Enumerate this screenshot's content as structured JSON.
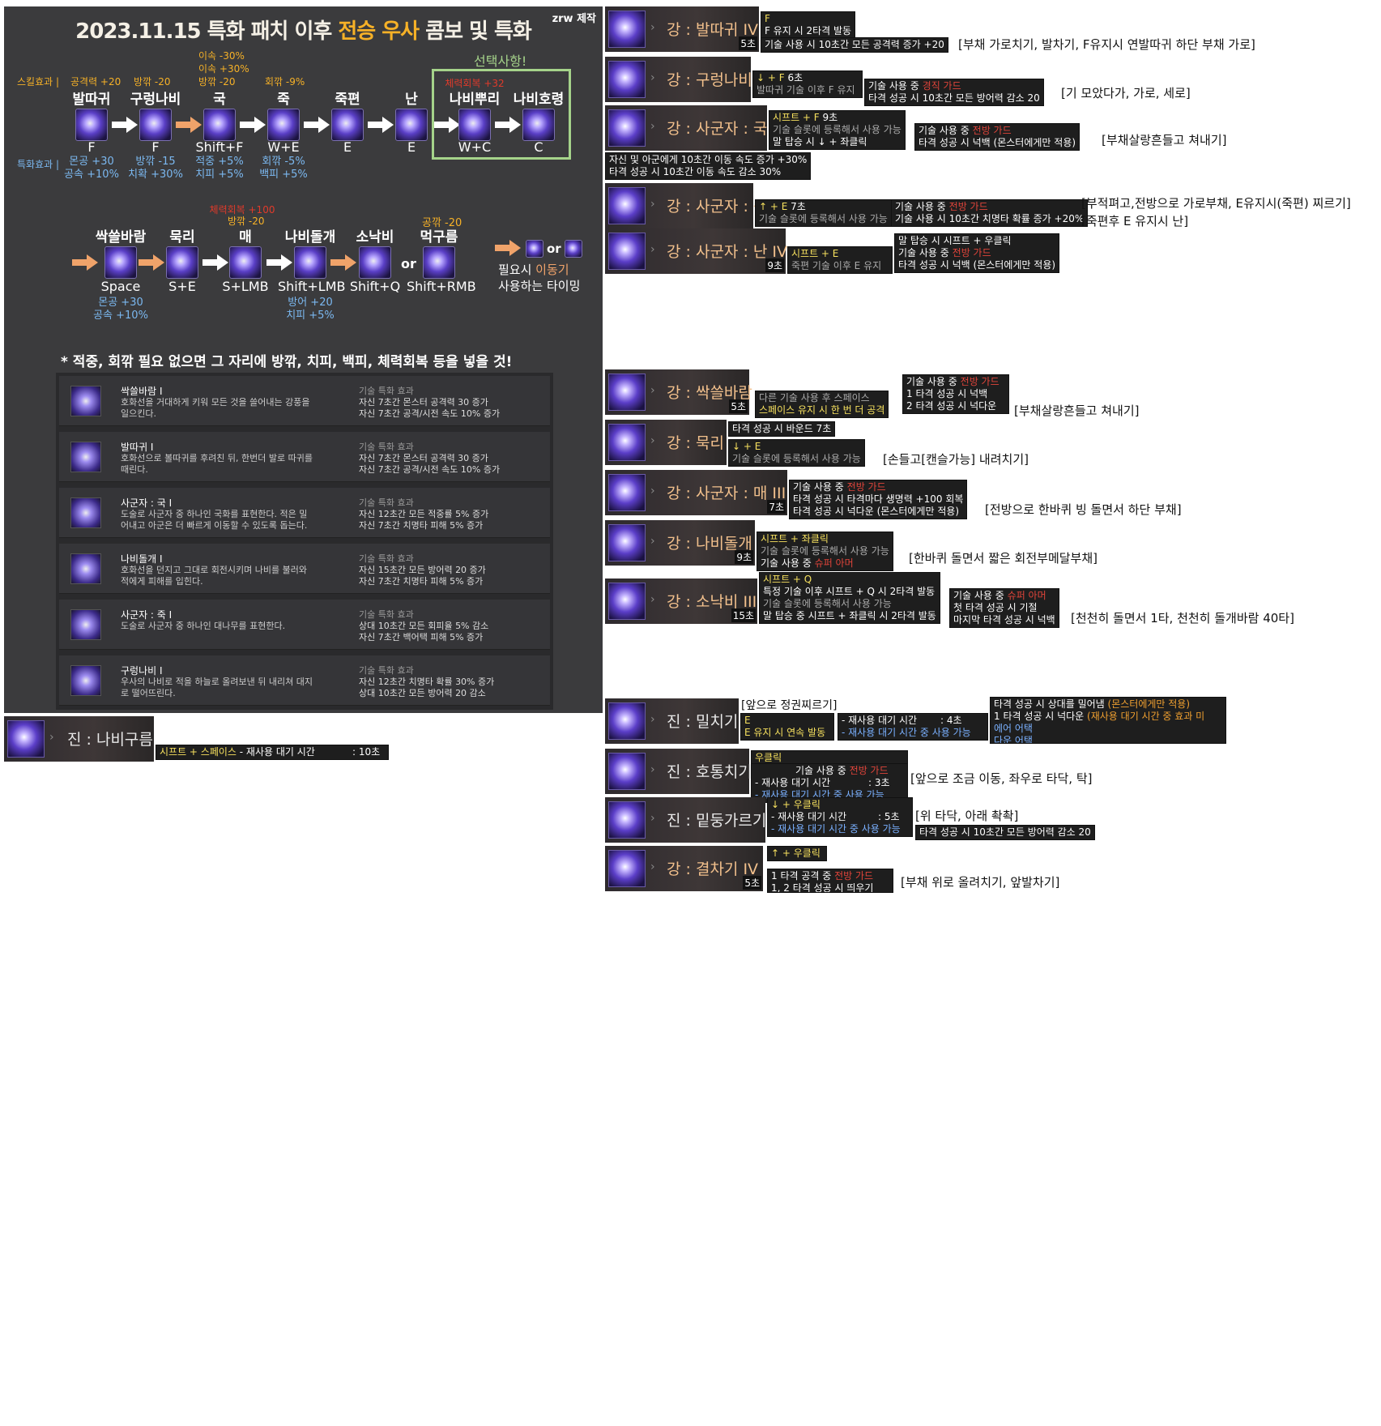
{
  "guide": {
    "title_pre": "2023.11.15 특화 패치 이후 ",
    "title_hl1": "전승 우사",
    "title_mid": " 콤보 및 특화",
    "credit": "zrw 제작",
    "skill_effect_label": "스킬효과 |",
    "spec_effect_label": "특화효과 |",
    "select_label": "선택사항!",
    "row1": [
      {
        "top": "공격력 +20",
        "name": "발따귀",
        "key": "F",
        "buff1": "몬공 +30",
        "buff2": "공속 +10%"
      },
      {
        "top": "방깎 -20",
        "name": "구렁나비",
        "key": "F",
        "buff1": "방깎 -15",
        "buff2": "치확 +30%"
      },
      {
        "top": "이속 -30%",
        "top2": "이속 +30%",
        "top3": "방깎 -20",
        "name": "국",
        "key": "Shift+F",
        "buff1": "적중 +5%",
        "buff2": "치피 +5%"
      },
      {
        "top": "회깎 -9%",
        "name": "죽",
        "key": "W+E",
        "buff1": "회깎 -5%",
        "buff2": "백피 +5%"
      },
      {
        "name": "죽편",
        "key": "E"
      },
      {
        "name": "난",
        "key": "E"
      },
      {
        "top_red": "체력회복 +32",
        "name": "나비뿌리",
        "key": "W+C"
      },
      {
        "name": "나비호령",
        "key": "C"
      }
    ],
    "row2": [
      {
        "name": "싹쓸바람",
        "key": "Space",
        "buff1": "몬공 +30",
        "buff2": "공속 +10%"
      },
      {
        "name": "묵리",
        "key": "S+E"
      },
      {
        "top_red": "체력회복 +100",
        "top": "방깎 -20",
        "name": "매",
        "key": "S+LMB"
      },
      {
        "name": "나비돌개",
        "key": "Shift+LMB",
        "buff1": "방어 +20",
        "buff2": "치피 +5%"
      },
      {
        "name": "소낙비",
        "key": "Shift+Q"
      },
      {
        "top": "공깎 -20",
        "name": "먹구름",
        "key": "Shift+RMB"
      }
    ],
    "or1": "or",
    "or2": "or",
    "move_note1": "필요시 ",
    "move_note_hl": "이동기",
    "move_note2": "사용하는 타이밍",
    "note": "* 적중, 회깎 필요 없으면 그 자리에 방깎, 치피, 백피, 체력회복 등을 넣을 것!",
    "effect_header": "기술 특화 효과",
    "table": [
      {
        "name": "싹쓸바람 I",
        "desc": "호화선을 거대하게 키워 모든 것을 쓸어내는 강풍을 일으킨다.",
        "e1": "자신 7초간 몬스터 공격력 30 증가",
        "e2": "자신 7초간 공격/시전 속도 10% 증가"
      },
      {
        "name": "발따귀 I",
        "desc": "호화선으로 볼따귀를 후려친 뒤, 한번더 발로 따귀를 때린다.",
        "e1": "자신 7초간 몬스터 공격력 30 증가",
        "e2": "자신 7초간 공격/시전 속도 10% 증가"
      },
      {
        "name": "사군자 : 국 I",
        "desc": "도술로 사군자 중 하나인 국화를 표현한다. 적은 밀어내고 아군은 더 빠르게 이동할 수 있도록 돕는다.",
        "e1": "자신 12초간 모든 적중률 5% 증가",
        "e2": "자신 7초간 치명타 피해 5% 증가"
      },
      {
        "name": "나비돌개 I",
        "desc": "호화선을 던지고 그대로 회전시키며 나비를 불러와 적에게 피해를 입힌다.",
        "e1": "자신 15초간 모든 방어력 20 증가",
        "e2": "자신 7초간 치명타 피해 5% 증가"
      },
      {
        "name": "사군자 : 죽 I",
        "desc": "도술로 사군자 중 하나인 대나무를 표현한다.",
        "e1": "상대 10초간 모든 회피율 5% 감소",
        "e2": "자신 7초간 백어택 피해 5% 증가"
      },
      {
        "name": "구렁나비 I",
        "desc": "우사의 나비로 적을 하늘로 올려보낸 뒤 내리쳐 대지로 떨어뜨린다.",
        "e1": "자신 12초간 치명타 확률 30% 증가",
        "e2": "상대 10초간 모든 방어력 20 감소"
      }
    ]
  },
  "bottom_skill": {
    "name": "진 : 나비구름",
    "keys": "시프트 + 스페이스",
    "cd_label": " - 재사용 대기 시간",
    "cd": ": 10초"
  },
  "skills": [
    {
      "name": "강 : 발따귀 IV",
      "cd": "5초",
      "tt1a": "F",
      "tt1b": "F 유지 시 2타격 발동",
      "tt2": "기술 사용 시 10초간 모든 공격력 증가 +20",
      "caption": "[부채 가로치기, 발차기, F유지시 연발따귀 하단 부채 가로]"
    },
    {
      "name": "강 : 구렁나비",
      "tt1a": "↓ + F",
      "tt1cd": "6초",
      "tt1b": "발따귀 기술 이후 F 유지",
      "tt2a": "기술 사용 중 ",
      "tt2ar": "경직 가드",
      "tt2b": "타격 성공 시 10초간 모든 방어력 감소 20",
      "caption": "[기 모았다가, 가로, 세로]"
    },
    {
      "name": "강 : 사군자 : 국",
      "tt1a": "시프트 + F",
      "tt1cd": "9초",
      "tt1b": "기술 슬롯에 등록해서 사용 가능",
      "tt1c": "말 탑승 시 ↓ + 좌클릭",
      "tt2a": "기술 사용 중 ",
      "tt2ar": "전방 가드",
      "tt2b": "타격 성공 시 넉백 (몬스터에게만 적용)",
      "tt3a": "자신 및 아군에게 10초간 이동 속도 증가 +30%",
      "tt3b": "타격 성공 시 10초간 이동 속도 감소 30%",
      "caption": "[부채살랑흔들고 쳐내기]"
    },
    {
      "name": "강 : 사군자 : 죽",
      "tt1a": "↑ + E",
      "tt1cd": "7초",
      "tt1b": "기술 슬롯에 등록해서 사용 가능",
      "tt2a": "기술 사용 중 ",
      "tt2ar": "전방 가드",
      "tt2b": "기술 사용 시 10초간 치명타 확률 증가 +20%",
      "caption1": "[부적펴고,전방으로 가로부채, E유지시(죽편) 찌르기]",
      "caption2": "[죽편후 E 유지시 난]"
    },
    {
      "name": "강 : 사군자 : 난 IV",
      "cd": "9초",
      "tt1a": "시프트 + E",
      "tt1b": "죽편 기술 이후 E 유지",
      "tt2a": "말 탑승 시 시프트 + 우클릭",
      "tt2b": "기술 사용 중 ",
      "tt2br": "전방 가드",
      "tt2c": "타격 성공 시 넉백 (몬스터에게만 적용)"
    },
    {
      "name": "강 : 싹쓸바람",
      "cd": "5초",
      "tt1a": "다른 기술 사용 후 스페이스",
      "tt1b": "스페이스 유지 시 한 번 더 공격",
      "tt2a": "기술 사용 중 ",
      "tt2ar": "전방 가드",
      "tt2b": "1 타격 성공 시 넉백",
      "tt2c": "2 타격 성공 시 넉다운",
      "caption": "[부채살랑흔들고 쳐내기]"
    },
    {
      "name": "강 : 묵리",
      "tt0": "타격 성공 시 바운드",
      "tt0cd": "7초",
      "tt1a": "↓ + E",
      "tt1b": "기술 슬롯에 등록해서 사용 가능",
      "caption": "[손들고[캔슬가능] 내려치기]"
    },
    {
      "name": "강 : 사군자 : 매 III",
      "cd": "7초",
      "tt1a": "기술 사용 중 ",
      "tt1ar": "전방 가드",
      "tt1b": "타격 성공 시 타격마다 생명력 +100 회복",
      "tt1c": "타격 성공 시 넉다운 (몬스터에게만 적용)",
      "caption": "[전방으로 한바퀴 빙 돌면서 하단 부채]"
    },
    {
      "name": "강 : 나비돌개",
      "cd": "9초",
      "tt1a": "시프트 + 좌클릭",
      "tt1b": "기술 슬롯에 등록해서 사용 가능",
      "tt1c": "기술 사용 중 ",
      "tt1cr": "슈퍼 아머",
      "caption": "[한바퀴 돌면서 짧은 회전부메달부채]"
    },
    {
      "name": "강 : 소낙비 III",
      "cd": "15초",
      "tt1a": "시프트 + Q",
      "tt1b": "특정 기술 이후 시프트 + Q 시 2타격 발동",
      "tt1c": "기술 슬롯에 등록해서 사용 가능",
      "tt1d": "말 탑승 중 시프트 + 좌클릭 시 2타격 발동",
      "tt2a": "기술 사용 중 ",
      "tt2ar": "슈퍼 아머",
      "tt2b": "첫 타격 성공 시 기절",
      "tt2c": "마지막 타격 성공 시 넉백",
      "caption": "[천천히 돌면서 1타, 천천히 돌개바람 40타]"
    },
    {
      "name": "진 : 밀치기",
      "caption_top": "[앞으로 정권찌르기]",
      "tt1a": "E",
      "tt1b": "E 유지 시 연속 발동",
      "tt2a": "- 재사용 대기 시간",
      "tt2acd": ": 4초",
      "tt2b": "- 재사용 대기 시간 중 사용 가능",
      "tt3a": "타격 성공 시 상대를 밀어냄 ",
      "tt3ar": "(몬스터에게만 적용)",
      "tt3b": "1 타격 성공 시 넉다운 ",
      "tt3br": "(재사용 대기 시간 중 효과 미",
      "tt3c": "에어 어택",
      "tt3d": "다운 어택"
    },
    {
      "name": "진 : 호통치기",
      "tt1a": "우클릭",
      "tt1b": "기술 사용 중 ",
      "tt1br": "전방 가드",
      "tt1c": "- 재사용 대기 시간",
      "tt1ccd": ": 3초",
      "tt1d": "- 재사용 대기 시간 중 사용 가능",
      "caption": "[앞으로 조금 이동, 좌우로 타닥, 탁]"
    },
    {
      "name": "진 : 밑둥가르기",
      "tt1a": "↓ + 우클릭",
      "tt1b": "- 재사용 대기 시간",
      "tt1bcd": ": 5초",
      "tt1c": "- 재사용 대기 시간 중 사용 가능",
      "caption_top": "[위 타닥, 아래 촥촥]",
      "tt2": "타격 성공 시 10초간 모든 방어력 감소 20"
    },
    {
      "name": "강 : 결차기 IV",
      "cd": "5초",
      "tt1a": "↑ + 우클릭",
      "tt1b": "1 타격 공격 중 ",
      "tt1br": "전방 가드",
      "tt1c": "1, 2 타격 성공 시 띄우기",
      "caption": "[부채 위로 올려치기, 앞발차기]"
    }
  ]
}
